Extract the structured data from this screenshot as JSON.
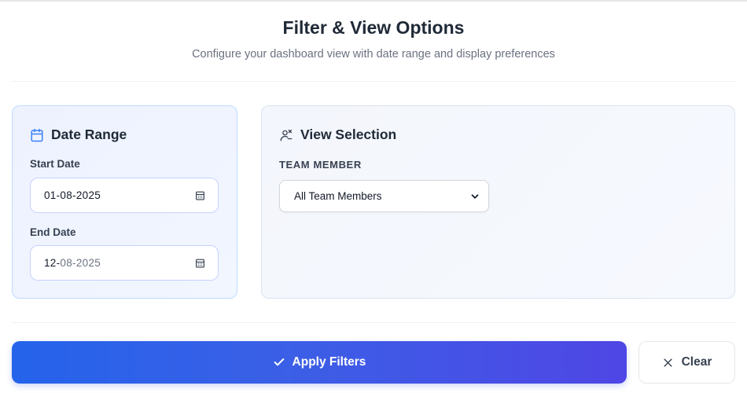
{
  "header": {
    "title": "Filter & View Options",
    "subtitle": "Configure your dashboard view with date range and display preferences"
  },
  "date_range": {
    "title": "Date Range",
    "icon": "calendar-icon",
    "start": {
      "label": "Start Date",
      "day": "01",
      "month": "08",
      "year": "2025"
    },
    "end": {
      "label": "End Date",
      "day": "12",
      "month": "08",
      "year": "2025"
    }
  },
  "view_selection": {
    "title": "View Selection",
    "icon": "person-view-icon",
    "team_member": {
      "label": "TEAM MEMBER",
      "selected": "All Team Members"
    }
  },
  "actions": {
    "apply_label": "Apply Filters",
    "clear_label": "Clear"
  },
  "colors": {
    "accent_start": "#2563eb",
    "accent_end": "#4f46e5",
    "icon_blue": "#3b82f6"
  }
}
